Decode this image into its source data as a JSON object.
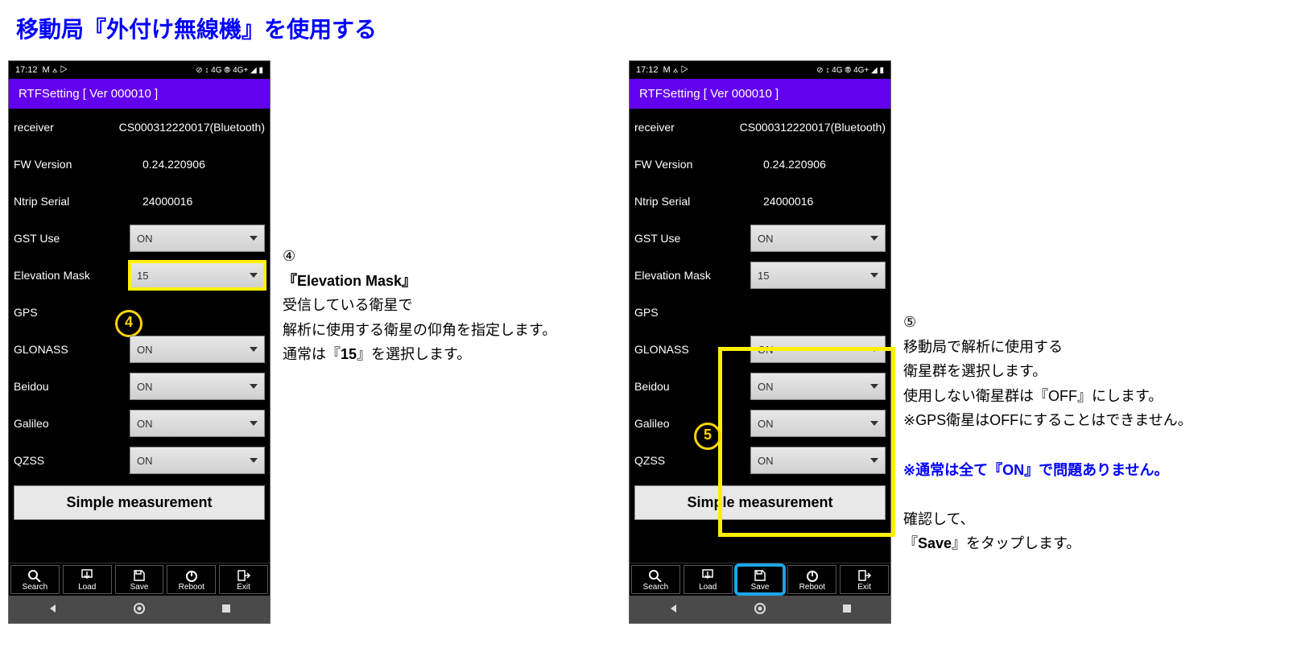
{
  "page_title": "移動局『外付け無線機』を使用する",
  "statusbar": {
    "time": "17:12",
    "indicators_left": "M ⟑ ▷",
    "indicators_right": "⊘ ↕ 4G ⦾ 4G+ ◢ ▮"
  },
  "appbar": {
    "title": "RTFSetting  [ Ver 000010 ]"
  },
  "rows": {
    "receiver": {
      "label": "receiver",
      "value": "CS000312220017(Bluetooth)"
    },
    "fw": {
      "label": "FW Version",
      "value": "0.24.220906"
    },
    "ntrip": {
      "label": "Ntrip Serial",
      "value": "24000016"
    },
    "gst": {
      "label": "GST Use",
      "value": "ON"
    },
    "elev": {
      "label": "Elevation Mask",
      "value": "15"
    },
    "gps": {
      "label": "GPS",
      "value": ""
    },
    "glonass": {
      "label": "GLONASS",
      "value": "ON"
    },
    "beidou": {
      "label": "Beidou",
      "value": "ON"
    },
    "galileo": {
      "label": "Galileo",
      "value": "ON"
    },
    "qzss": {
      "label": "QZSS",
      "value": "ON"
    }
  },
  "simple_btn": "Simple measurement",
  "toolbar": {
    "search": "Search",
    "load": "Load",
    "save": "Save",
    "reboot": "Reboot",
    "exit": "Exit"
  },
  "markers": {
    "m4": "4",
    "m5": "5"
  },
  "ann4": {
    "num": "④",
    "title": "『Elevation Mask』",
    "l1": "受信している衛星で",
    "l2": "解析に使用する衛星の仰角を指定します。",
    "l3_a": "通常は『",
    "l3_b": "15",
    "l3_c": "』を選択します。"
  },
  "ann5": {
    "num": "⑤",
    "l1": "移動局で解析に使用する",
    "l2": "衛星群を選択します。",
    "l3": "使用しない衛星群は『OFF』にします。",
    "l4": "※GPS衛星はOFFにすることはできません。",
    "blue": "※通常は全て『ON』で問題ありません。",
    "c1": "確認して、",
    "c2_a": "『",
    "c2_b": "Save",
    "c2_c": "』をタップします。"
  }
}
